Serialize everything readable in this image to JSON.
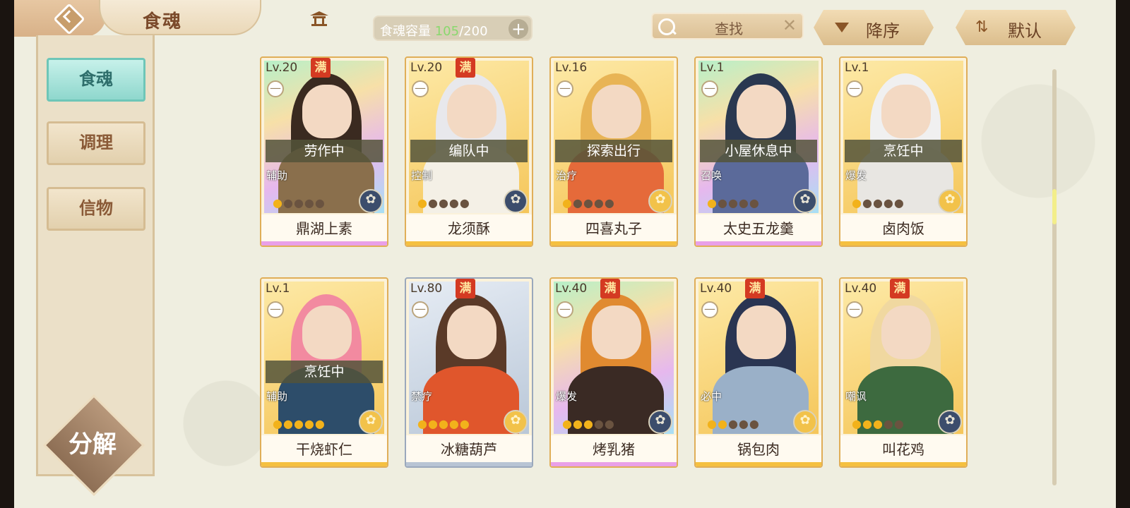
{
  "header": {
    "title": "食魂",
    "capacity": {
      "label": "食魂容量 ",
      "current": "105",
      "max": "/200"
    },
    "search_text": "查找",
    "sort_order_label": "降序",
    "sort_default_label": "默认"
  },
  "sidebar": {
    "items": [
      {
        "label": "食魂",
        "active": true
      },
      {
        "label": "调理",
        "active": false
      },
      {
        "label": "信物",
        "active": false
      }
    ],
    "decompose_label": "分解"
  },
  "cards": [
    {
      "level": "Lv.20",
      "maxed": true,
      "max_label": "满",
      "status": "劳作中",
      "role": "辅助",
      "stars": 1,
      "name": "鼎湖上素",
      "rarity": "rainbow",
      "hair": "#3a2a20",
      "body": "#8a6f4c",
      "emblem": "dark"
    },
    {
      "level": "Lv.20",
      "maxed": true,
      "max_label": "满",
      "status": "编队中",
      "role": "控制",
      "stars": 1,
      "name": "龙须酥",
      "rarity": "gold",
      "hair": "#e8e8ec",
      "body": "#f4f0e6",
      "emblem": "dark"
    },
    {
      "level": "Lv.16",
      "maxed": false,
      "max_label": "",
      "status": "探索出行",
      "role": "治疗",
      "stars": 1,
      "name": "四喜丸子",
      "rarity": "gold",
      "hair": "#e8b455",
      "body": "#e56a3a",
      "emblem": "gold"
    },
    {
      "level": "Lv.1",
      "maxed": false,
      "max_label": "",
      "status": "小屋休息中",
      "role": "召唤",
      "stars": 1,
      "name": "太史五龙羹",
      "rarity": "rainbow",
      "hair": "#2a3850",
      "body": "#5b6a9a",
      "emblem": "dark"
    },
    {
      "level": "Lv.1",
      "maxed": false,
      "max_label": "",
      "status": "烹饪中",
      "role": "爆发",
      "stars": 1,
      "name": "卤肉饭",
      "rarity": "gold",
      "hair": "#f0f0f0",
      "body": "#e8e6e2",
      "emblem": "gold"
    },
    {
      "level": "Lv.1",
      "maxed": false,
      "max_label": "",
      "status": "烹饪中",
      "role": "辅助",
      "stars": 5,
      "name": "干烧虾仁",
      "rarity": "gold",
      "hair": "#f28aa0",
      "body": "#2d4d6a",
      "emblem": "gold"
    },
    {
      "level": "Lv.80",
      "maxed": true,
      "max_label": "满",
      "status": "",
      "role": "禁疗",
      "stars": 5,
      "name": "冰糖葫芦",
      "rarity": "silver",
      "hair": "#5a3a28",
      "body": "#e0562c",
      "emblem": "gold"
    },
    {
      "level": "Lv.40",
      "maxed": true,
      "max_label": "满",
      "status": "",
      "role": "爆发",
      "stars": 3,
      "name": "烤乳猪",
      "rarity": "rainbow",
      "hair": "#e08a30",
      "body": "#3a2a24",
      "emblem": "dark"
    },
    {
      "level": "Lv.40",
      "maxed": true,
      "max_label": "满",
      "status": "",
      "role": "必中",
      "stars": 2,
      "name": "锅包肉",
      "rarity": "gold",
      "hair": "#2a3552",
      "body": "#9ab0c8",
      "emblem": "gold"
    },
    {
      "level": "Lv.40",
      "maxed": true,
      "max_label": "满",
      "status": "",
      "role": "嘲讽",
      "stars": 3,
      "name": "叫花鸡",
      "rarity": "gold",
      "hair": "#f0d8a0",
      "body": "#3d6a3f",
      "emblem": "dark"
    }
  ],
  "colors": {
    "rarity_gold": "#f5c040",
    "rarity_rainbow": "#e9a0e8",
    "rarity_silver": "#b8c4d4",
    "active_tab": "#8fd7cd"
  }
}
